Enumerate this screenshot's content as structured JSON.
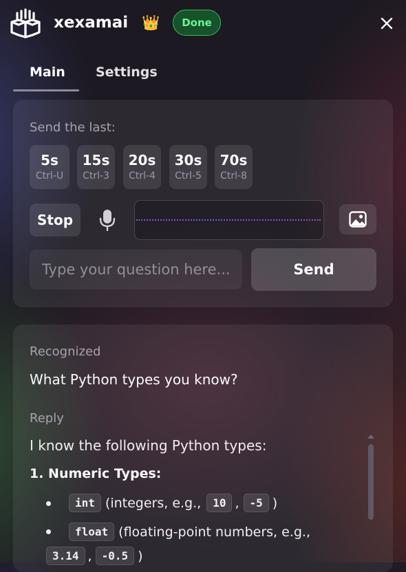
{
  "header": {
    "app_name": "xexamai",
    "crown_icon": "crown-icon",
    "status_badge": "Done",
    "colors": {
      "badge_border": "#2fbf55",
      "badge_text": "#6cf28f",
      "badge_bg": "#16522a"
    }
  },
  "tabs": [
    {
      "label": "Main",
      "active": true
    },
    {
      "label": "Settings",
      "active": false
    }
  ],
  "capture": {
    "send_last_label": "Send the last:",
    "durations": [
      {
        "time": "5s",
        "shortcut": "Ctrl-U"
      },
      {
        "time": "15s",
        "shortcut": "Ctrl-3"
      },
      {
        "time": "20s",
        "shortcut": "Ctrl-4"
      },
      {
        "time": "30s",
        "shortcut": "Ctrl-5"
      },
      {
        "time": "70s",
        "shortcut": "Ctrl-8"
      }
    ],
    "stop_label": "Stop",
    "mic_icon": "microphone-icon",
    "image_icon": "image-icon",
    "wave_color": "#8a4fd6"
  },
  "question": {
    "placeholder": "Type your question here...",
    "value": "",
    "send_label": "Send"
  },
  "result": {
    "recognized_label": "Recognized",
    "recognized_text": "What Python types you know?",
    "reply_label": "Reply",
    "reply_intro": "I know the following Python types:",
    "reply_heading": "1. Numeric Types:",
    "items": [
      {
        "code": "int",
        "text": "(integers, e.g.,",
        "ex1": "10",
        "sep": ",",
        "ex2": "-5",
        "end": ")"
      },
      {
        "code": "float",
        "text": "(floating-point numbers, e.g.,",
        "ex1": "3.14",
        "sep": ",",
        "ex2": "-0.5",
        "end": ")"
      }
    ]
  }
}
